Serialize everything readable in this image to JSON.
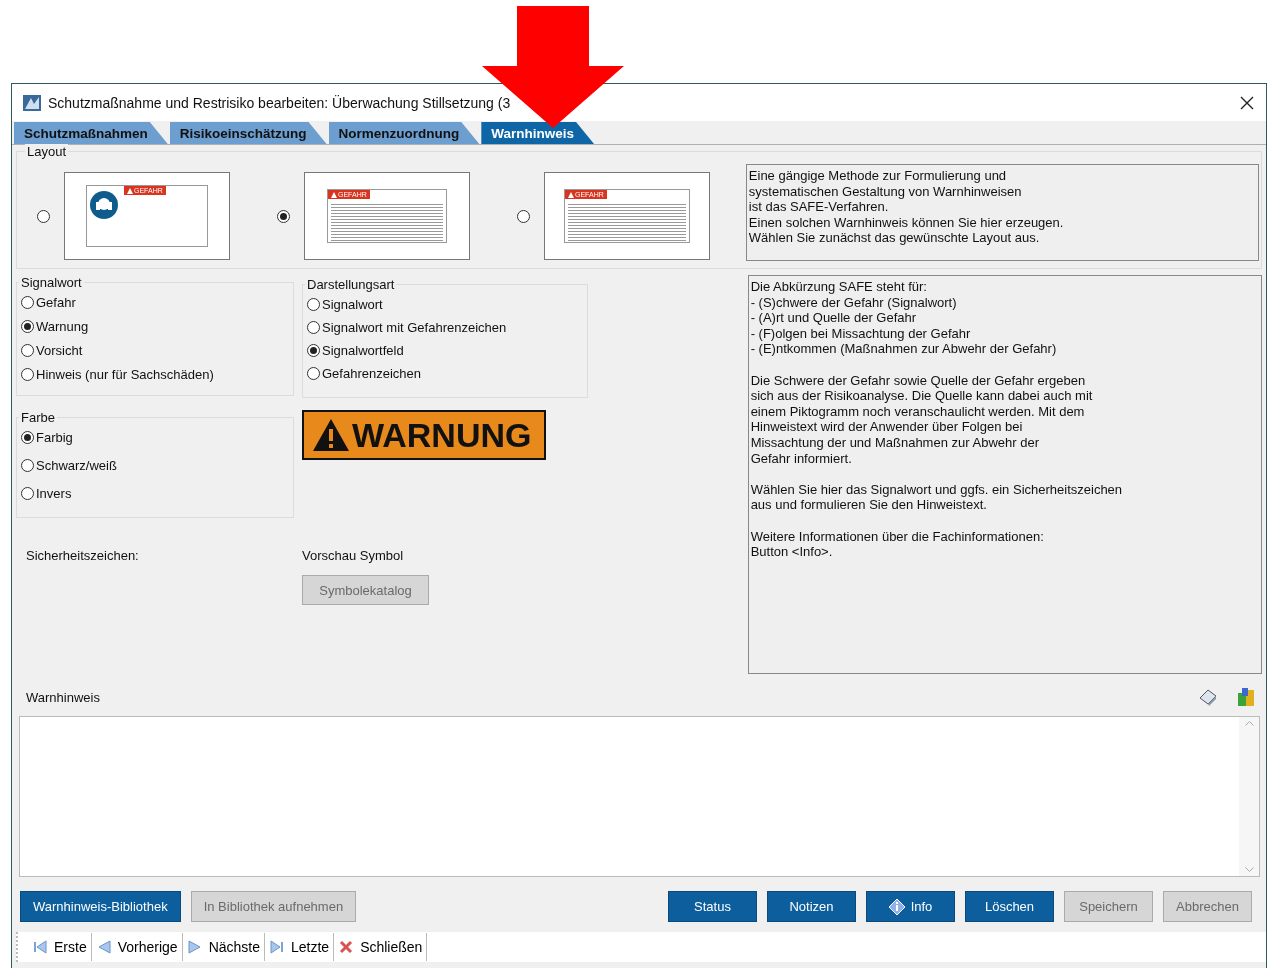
{
  "window": {
    "title": "Schutzmaßnahme und Restrisiko bearbeiten: Überwachung Stillsetzung (3"
  },
  "tabs": [
    {
      "label": "Schutzmaßnahmen",
      "selected": false
    },
    {
      "label": "Risikoeinschätzung",
      "selected": false
    },
    {
      "label": "Normenzuordnung",
      "selected": false
    },
    {
      "label": "Warnhinweis",
      "selected": true
    }
  ],
  "layout": {
    "label": "Layout",
    "options": [
      {
        "kind": "symbol_left",
        "badge": "GEFAHR",
        "selected": false
      },
      {
        "kind": "text_below",
        "badge": "GEFAHR",
        "selected": true
      },
      {
        "kind": "text_beside",
        "badge": "GEFAHR",
        "selected": false
      }
    ],
    "intro": [
      "Eine gängige Methode zur Formulierung und",
      "systematischen Gestaltung von Warnhinweisen",
      "ist das SAFE-Verfahren.",
      "Einen solchen Warnhinweis können Sie hier erzeugen.",
      "Wählen Sie zunächst das gewünschte Layout aus."
    ]
  },
  "signalwort": {
    "label": "Signalwort",
    "options": [
      {
        "label": "Gefahr",
        "selected": false
      },
      {
        "label": "Warnung",
        "selected": true
      },
      {
        "label": "Vorsicht",
        "selected": false
      },
      {
        "label": "Hinweis (nur für Sachschäden)",
        "selected": false
      }
    ]
  },
  "darstellungsart": {
    "label": "Darstellungsart",
    "options": [
      {
        "label": "Signalwort",
        "selected": false
      },
      {
        "label": "Signalwort mit Gefahrenzeichen",
        "selected": false
      },
      {
        "label": "Signalwortfeld",
        "selected": true
      },
      {
        "label": "Gefahrenzeichen",
        "selected": false
      }
    ]
  },
  "farbe": {
    "label": "Farbe",
    "options": [
      {
        "label": "Farbig",
        "selected": true
      },
      {
        "label": "Schwarz/weiß",
        "selected": false
      },
      {
        "label": "Invers",
        "selected": false
      }
    ]
  },
  "signal_field": {
    "text": "WARNUNG",
    "color": "#e8891c"
  },
  "sicherheitszeichen_label": "Sicherheitszeichen:",
  "vorschau_label": "Vorschau Symbol",
  "symbolkatalog": {
    "label": "Symbolekatalog",
    "disabled": true
  },
  "info": [
    [
      "Die Abkürzung SAFE steht für:",
      "- (S)chwere der Gefahr (Signalwort)",
      "- (A)rt und Quelle der Gefahr",
      "- (F)olgen bei Missachtung der Gefahr",
      "- (E)ntkommen (Maßnahmen zur Abwehr der Gefahr)"
    ],
    [
      "Die Schwere der Gefahr sowie Quelle der Gefahr ergeben",
      "sich aus der Risikoanalyse. Die Quelle kann dabei auch mit",
      "einem Piktogramm noch veranschaulicht werden. Mit dem",
      "Hinweistext wird der Anwender über Folgen bei",
      "Missachtung der und Maßnahmen zur Abwehr der",
      "Gefahr informiert."
    ],
    [
      "Wählen Sie hier das Signalwort und ggfs. ein Sicherheitszeichen",
      "aus und formulieren Sie den Hinweistext."
    ],
    [
      "Weitere Informationen über die Fachinformationen:",
      "Button <Info>."
    ]
  ],
  "warnhinweis": {
    "label": "Warnhinweis"
  },
  "buttons_left": [
    {
      "label": "Warnhinweis-Bibliothek",
      "disabled": false
    },
    {
      "label": "In Bibliothek aufnehmen",
      "disabled": true
    }
  ],
  "buttons_right": [
    {
      "label": "Status",
      "disabled": false,
      "kind": "plain"
    },
    {
      "label": "Notizen",
      "disabled": false,
      "kind": "plain"
    },
    {
      "label": "Info",
      "disabled": false,
      "kind": "info"
    },
    {
      "label": "Löschen",
      "disabled": false,
      "kind": "plain"
    },
    {
      "label": "Speichern",
      "disabled": true,
      "kind": "plain"
    },
    {
      "label": "Abbrechen",
      "disabled": true,
      "kind": "plain"
    }
  ],
  "navigation": [
    {
      "label": "Erste",
      "kind": "first"
    },
    {
      "label": "Vorherige",
      "kind": "prev"
    },
    {
      "label": "Nächste",
      "kind": "next"
    },
    {
      "label": "Letzte",
      "kind": "last"
    },
    {
      "label": "Schließen",
      "kind": "close"
    }
  ]
}
